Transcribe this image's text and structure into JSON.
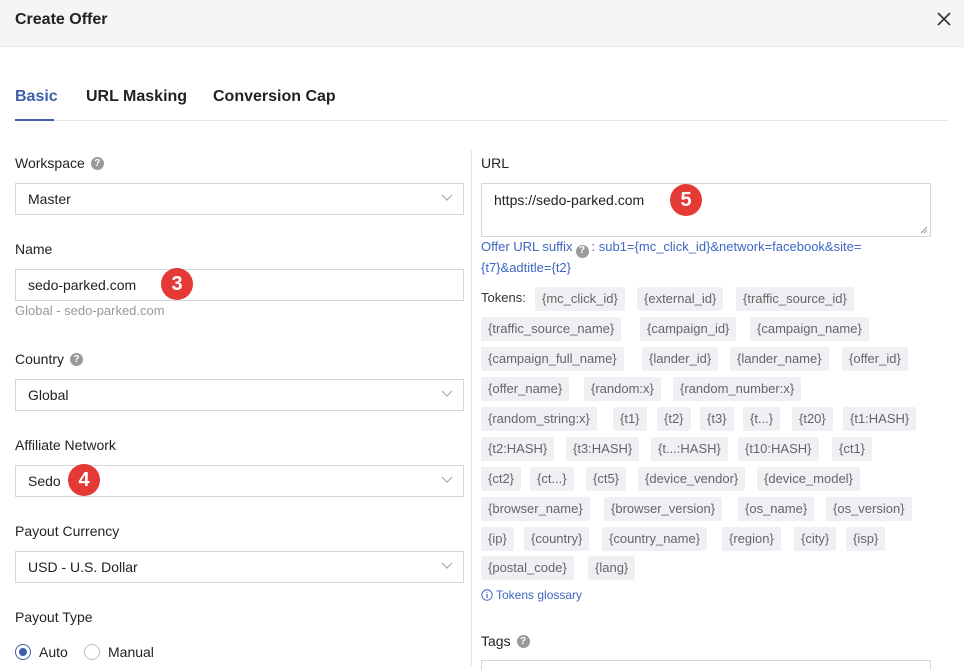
{
  "header": {
    "title": "Create Offer"
  },
  "tabs": [
    {
      "label": "Basic",
      "active": true
    },
    {
      "label": "URL Masking"
    },
    {
      "label": "Conversion Cap"
    }
  ],
  "workspace": {
    "label": "Workspace",
    "value": "Master"
  },
  "name": {
    "label": "Name",
    "value": "sedo-parked.com",
    "hint": "Global - sedo-parked.com"
  },
  "country": {
    "label": "Country",
    "value": "Global"
  },
  "affiliate_network": {
    "label": "Affiliate Network",
    "value": "Sedo"
  },
  "payout_currency": {
    "label": "Payout Currency",
    "value": "USD - U.S. Dollar"
  },
  "payout_type": {
    "label": "Payout Type",
    "options": [
      "Auto",
      "Manual"
    ],
    "selected": "Auto"
  },
  "url": {
    "label": "URL",
    "value": "https://sedo-parked.com",
    "suffix_label": "Offer URL suffix",
    "suffix_value_1": ": sub1={mc_click_id}&network=facebook&site=",
    "suffix_value_2": "{t7}&adtitle={t2}"
  },
  "tokens": {
    "label": "Tokens:",
    "items": [
      "{mc_click_id}",
      "{external_id}",
      "{traffic_source_id}",
      "{traffic_source_name}",
      "{campaign_id}",
      "{campaign_name}",
      "{campaign_full_name}",
      "{lander_id}",
      "{lander_name}",
      "{offer_id}",
      "{offer_name}",
      "{random:x}",
      "{random_number:x}",
      "{random_string:x}",
      "{t1}",
      "{t2}",
      "{t3}",
      "{t...}",
      "{t20}",
      "{t1:HASH}",
      "{t2:HASH}",
      "{t3:HASH}",
      "{t...:HASH}",
      "{t10:HASH}",
      "{ct1}",
      "{ct2}",
      "{ct...}",
      "{ct5}",
      "{device_vendor}",
      "{device_model}",
      "{browser_name}",
      "{browser_version}",
      "{os_name}",
      "{os_version}",
      "{ip}",
      "{country}",
      "{country_name}",
      "{region}",
      "{city}",
      "{isp}",
      "{postal_code}",
      "{lang}"
    ],
    "glossary": "Tokens glossary"
  },
  "tags": {
    "label": "Tags"
  },
  "badges": {
    "name": "3",
    "network": "4",
    "url": "5"
  },
  "colors": {
    "accent": "#3d5fa8",
    "badge": "#e53935",
    "link": "#3d67c0"
  }
}
